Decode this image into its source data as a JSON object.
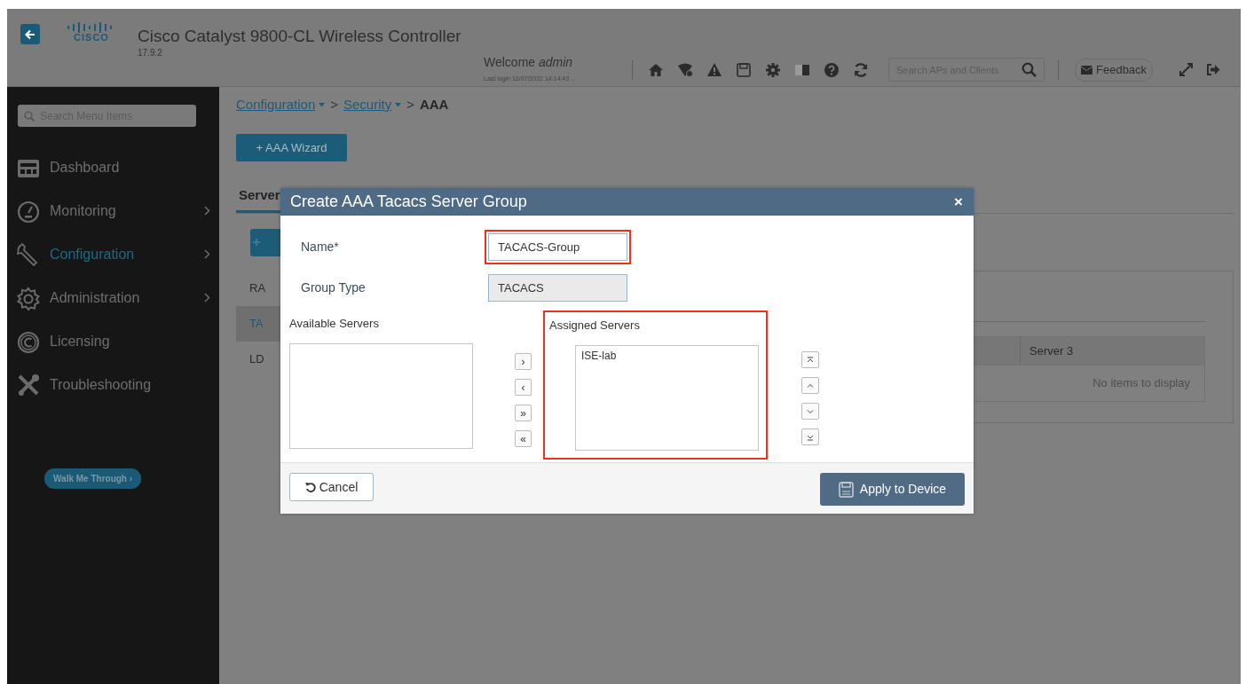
{
  "header": {
    "logo_text": "CISCO",
    "title": "Cisco Catalyst 9800-CL Wireless Controller",
    "version": "17.9.2",
    "welcome": "Welcome",
    "user": "admin",
    "last_login": "Last login 12/07/2022 14:14:43 ...",
    "search_placeholder": "Search APs and Clients",
    "feedback": "Feedback"
  },
  "sidebar": {
    "search_placeholder": "Search Menu Items",
    "items": [
      {
        "label": "Dashboard",
        "selected": false,
        "has_submenu": false
      },
      {
        "label": "Monitoring",
        "selected": false,
        "has_submenu": true
      },
      {
        "label": "Configuration",
        "selected": true,
        "has_submenu": true
      },
      {
        "label": "Administration",
        "selected": false,
        "has_submenu": true
      },
      {
        "label": "Licensing",
        "selected": false,
        "has_submenu": false
      },
      {
        "label": "Troubleshooting",
        "selected": false,
        "has_submenu": false
      }
    ],
    "walk_me_through": "Walk Me Through ›"
  },
  "breadcrumb": [
    {
      "label": "Configuration",
      "dropdown": true
    },
    {
      "label": "Security",
      "dropdown": true
    },
    {
      "label": "AAA",
      "dropdown": false
    }
  ],
  "breadcrumb_separator": ">",
  "wizard_button": "+ AAA Wizard",
  "tabs": [
    {
      "label": "Server",
      "selected": true
    }
  ],
  "side_list": [
    {
      "label": "RA",
      "selected": false
    },
    {
      "label": "TA",
      "selected": true
    },
    {
      "label": "LD",
      "selected": false
    }
  ],
  "table": {
    "columns": [
      "Server 3"
    ],
    "empty_text": "No items to display"
  },
  "dialog": {
    "title": "Create AAA Tacacs Server Group",
    "close": "×",
    "fields": [
      {
        "label": "Name*",
        "value": "TACACS-Group",
        "disabled": false,
        "highlighted": true
      },
      {
        "label": "Group Type",
        "value": "TACACS",
        "disabled": true
      }
    ],
    "available": {
      "label": "Available Servers"
    },
    "move_buttons": [
      "›",
      "‹",
      "»",
      "«"
    ],
    "assigned": {
      "label": "Assigned Servers",
      "highlighted": true,
      "items": [
        {
          "label": "ISE-lab",
          "selected": false
        }
      ]
    },
    "cancel": "Cancel",
    "apply": "Apply to Device"
  }
}
